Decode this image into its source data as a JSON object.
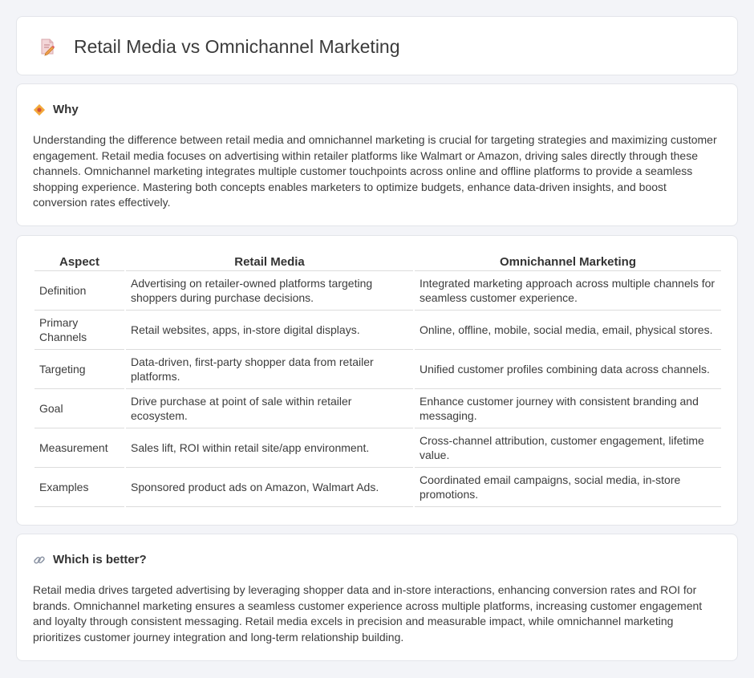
{
  "header": {
    "title": "Retail Media vs Omnichannel Marketing",
    "icon": "document-pencil-icon"
  },
  "why": {
    "heading": "Why",
    "icon": "diamond-badge-icon",
    "text": "Understanding the difference between retail media and omnichannel marketing is crucial for targeting strategies and maximizing customer engagement. Retail media focuses on advertising within retailer platforms like Walmart or Amazon, driving sales directly through these channels. Omnichannel marketing integrates multiple customer touchpoints across online and offline platforms to provide a seamless shopping experience. Mastering both concepts enables marketers to optimize budgets, enhance data-driven insights, and boost conversion rates effectively."
  },
  "comparison": {
    "headers": [
      "Aspect",
      "Retail Media",
      "Omnichannel Marketing"
    ],
    "rows": [
      [
        "Definition",
        "Advertising on retailer-owned platforms targeting shoppers during purchase decisions.",
        "Integrated marketing approach across multiple channels for seamless customer experience."
      ],
      [
        "Primary Channels",
        "Retail websites, apps, in-store digital displays.",
        "Online, offline, mobile, social media, email, physical stores."
      ],
      [
        "Targeting",
        "Data-driven, first-party shopper data from retailer platforms.",
        "Unified customer profiles combining data across channels."
      ],
      [
        "Goal",
        "Drive purchase at point of sale within retailer ecosystem.",
        "Enhance customer journey with consistent branding and messaging."
      ],
      [
        "Measurement",
        "Sales lift, ROI within retail site/app environment.",
        "Cross-channel attribution, customer engagement, lifetime value."
      ],
      [
        "Examples",
        "Sponsored product ads on Amazon, Walmart Ads.",
        "Coordinated email campaigns, social media, in-store promotions."
      ]
    ]
  },
  "which": {
    "heading": "Which is better?",
    "icon": "link-icon",
    "text": "Retail media drives targeted advertising by leveraging shopper data and in-store interactions, enhancing conversion rates and ROI for brands. Omnichannel marketing ensures a seamless customer experience across multiple platforms, increasing customer engagement and loyalty through consistent messaging. Retail media excels in precision and measurable impact, while omnichannel marketing prioritizes customer journey integration and long-term relationship building."
  }
}
